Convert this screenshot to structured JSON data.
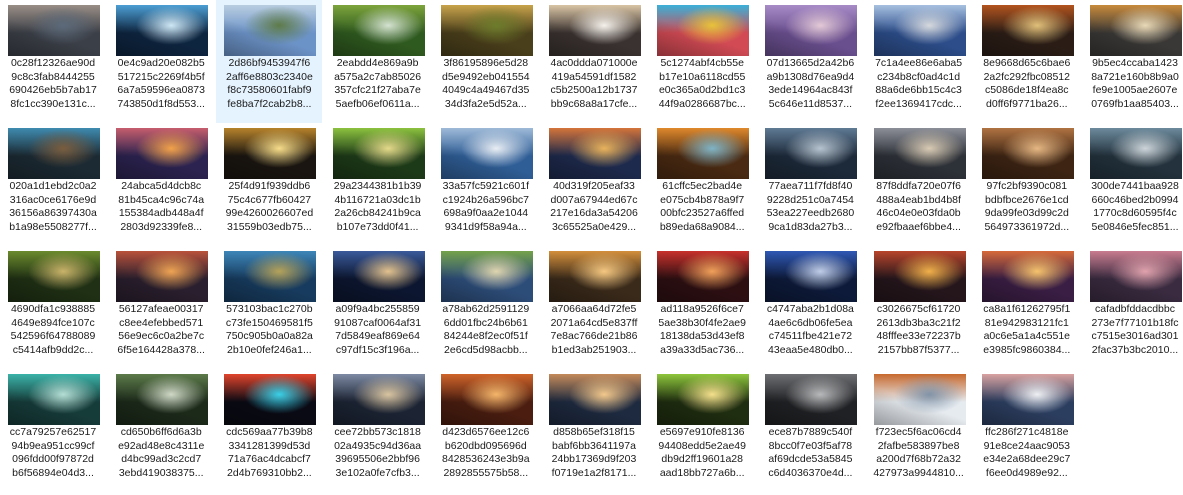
{
  "files": [
    {
      "lines": [
        "0c28f12326ae90d",
        "9c8c3fab8444255",
        "690426eb5b7ab17",
        "8fc1cc390e131c..."
      ],
      "icon": "image-thumbnail-canyon",
      "selected": false,
      "colors": [
        "#3b3f47",
        "#9a8e86",
        "#5c6a7a"
      ]
    },
    {
      "lines": [
        "0e4c9ad20e082b5",
        "517215c2269f4b5f",
        "6a7a59596ea0873",
        "743850d1f8d553..."
      ],
      "icon": "image-thumbnail-ice-cave",
      "selected": false,
      "colors": [
        "#0e2540",
        "#4c9fd4",
        "#cfe7f5"
      ]
    },
    {
      "lines": [
        "2d86bf9453947f6",
        "2aff6e8803c2340e",
        "f8c73580601fabf9",
        "fe8ba7f2cab2b8..."
      ],
      "icon": "image-thumbnail-mountain-valley",
      "selected": true,
      "colors": [
        "#6c93c8",
        "#b9cde0",
        "#5e7b49"
      ]
    },
    {
      "lines": [
        "2eabdd4e869a9b",
        "a575a2c7ab85026",
        "357cfc21f27aba7e",
        "5aefb06ef0611a..."
      ],
      "icon": "image-thumbnail-waterfall",
      "selected": false,
      "colors": [
        "#2f5a1f",
        "#7da43c",
        "#d4e2d0"
      ]
    },
    {
      "lines": [
        "3f86195896e5d28",
        "d5e9492eb041554",
        "4049c4a49467d35",
        "34d3fa2e5d52a..."
      ],
      "icon": "image-thumbnail-forest-path",
      "selected": false,
      "colors": [
        "#4a3f1b",
        "#c8a34b",
        "#6d7c2c"
      ]
    },
    {
      "lines": [
        "4ac0ddda071000e",
        "419a54591df1582",
        "c5b2500a12b1737",
        "bb9c68a8a17cfe..."
      ],
      "icon": "image-thumbnail-snowy-sunset",
      "selected": false,
      "colors": [
        "#3a3230",
        "#d9c4a4",
        "#f5f1eb"
      ]
    },
    {
      "lines": [
        "5c1274abf4cb55e",
        "b17e10a6118cd55",
        "e0c365a0d2bd1c3",
        "44f9a0286687bc..."
      ],
      "icon": "image-thumbnail-paint-pots",
      "selected": false,
      "colors": [
        "#d14a54",
        "#3bb0d8",
        "#e8c23a"
      ]
    },
    {
      "lines": [
        "07d13665d2a42b6",
        "a9b1308d76ea9d4",
        "3ede14964ac843f",
        "5c646e11d8537..."
      ],
      "icon": "image-thumbnail-lavender-field",
      "selected": false,
      "colors": [
        "#6a4f8f",
        "#a78bc7",
        "#e3c9d6"
      ]
    },
    {
      "lines": [
        "7c1a4ee86e6aba5",
        "c234b8cf0ad4c1d",
        "88a6de6bb15c4c3",
        "f2ee1369417cdc..."
      ],
      "icon": "image-thumbnail-bridge",
      "selected": false,
      "colors": [
        "#2c4d8a",
        "#a7c0e0",
        "#d6d9dd"
      ]
    },
    {
      "lines": [
        "8e9668d65c6bae6",
        "2a2fc292fbc08512",
        "c5086de18f4ea8c",
        "d0ff6f9771ba26..."
      ],
      "icon": "image-thumbnail-spices",
      "selected": false,
      "colors": [
        "#2b1d16",
        "#b3541e",
        "#e0c07a"
      ]
    },
    {
      "lines": [
        "9b5ec4ccaba1423",
        "8a721e160b8b9a0",
        "fe9e1005ae2607e",
        "0769fb1aa85403..."
      ],
      "icon": "image-thumbnail-spice-bowls",
      "selected": false,
      "colors": [
        "#3a3836",
        "#c88a3c",
        "#e8d9b8"
      ]
    },
    {
      "lines": [
        "020a1d1ebd2c0a2",
        "316ac0ce6176e9d",
        "36156a86397430a",
        "b1a98e5508277f..."
      ],
      "icon": "image-thumbnail-cave-lake",
      "selected": false,
      "colors": [
        "#1c2a33",
        "#3f8bb0",
        "#7a5d3e"
      ]
    },
    {
      "lines": [
        "24abca5d4dcb8c",
        "81b45ca4c96c74a",
        "155384adb448a4f",
        "2803d92339fe8..."
      ],
      "icon": "image-thumbnail-pier-sunset",
      "selected": false,
      "colors": [
        "#2c2350",
        "#c65d6d",
        "#f2a24a"
      ]
    },
    {
      "lines": [
        "25f4d91f939ddb6",
        "75c4c677fb60427",
        "99e4260026607ed",
        "31559b03edb75..."
      ],
      "icon": "image-thumbnail-light-bulb",
      "selected": false,
      "colors": [
        "#1a1510",
        "#b7832c",
        "#f6dc8a"
      ]
    },
    {
      "lines": [
        "29a2344381b1b39",
        "4b116721a03dc1b",
        "2a26cb84241b9ca",
        "b107e73dd0f41..."
      ],
      "icon": "image-thumbnail-green-corridor",
      "selected": false,
      "colors": [
        "#1d3a18",
        "#8cc23f",
        "#e4d98a"
      ]
    },
    {
      "lines": [
        "33a57fc5921c601f",
        "c1924b26a596bc7",
        "698a9f0aa2e1044",
        "9341d9f58a94a..."
      ],
      "icon": "image-thumbnail-lake-reflection",
      "selected": false,
      "colors": [
        "#2f5e96",
        "#9fbad8",
        "#e9eef4"
      ]
    },
    {
      "lines": [
        "40d319f205eaf33",
        "d007a67944ed67c",
        "217e16da3a54206",
        "3c65525a0e429..."
      ],
      "icon": "image-thumbnail-canal-houses",
      "selected": false,
      "colors": [
        "#1e2a4d",
        "#d4743a",
        "#e8b35c"
      ]
    },
    {
      "lines": [
        "61cffc5ec2bad4e",
        "e075cb4b878a9f7",
        "00bfc23527a6ffed",
        "b89eda68a9084..."
      ],
      "icon": "image-thumbnail-autumn-waterfall",
      "selected": false,
      "colors": [
        "#4a2a12",
        "#e0892c",
        "#7fb4c7"
      ]
    },
    {
      "lines": [
        "77aea711f7fd8f40",
        "9228d251c0a7454",
        "53ea227eedb2680",
        "9ca1d83da27b3..."
      ],
      "icon": "image-thumbnail-rocky-coast",
      "selected": false,
      "colors": [
        "#1d2a3a",
        "#5f7a94",
        "#b6c3cf"
      ]
    },
    {
      "lines": [
        "87f8ddfa720e07f6",
        "488a4eab1bd4b8f",
        "46c04e0e03fda0b",
        "e92fbaaef6bbe4..."
      ],
      "icon": "image-thumbnail-misty-peaks",
      "selected": false,
      "colors": [
        "#2d3138",
        "#8c8f98",
        "#d9cbb4"
      ]
    },
    {
      "lines": [
        "97fc2bf9390c081",
        "bdbfbce2676e1cd",
        "9da99fe03d99c2d",
        "564973361972d..."
      ],
      "icon": "image-thumbnail-wooden-columns",
      "selected": false,
      "colors": [
        "#3d2413",
        "#b07342",
        "#e6b783"
      ]
    },
    {
      "lines": [
        "300de7441baa928",
        "660c46bed2b0994",
        "1770c8d60595f4c",
        "5e0846e5fec851..."
      ],
      "icon": "image-thumbnail-ocean-rocks",
      "selected": false,
      "colors": [
        "#23323d",
        "#6c8a9c",
        "#cdd5da"
      ]
    },
    {
      "lines": [
        "4690dfa1c938885",
        "4649e894fce107c",
        "542596f64788089",
        "c5414afb9dd2c..."
      ],
      "icon": "image-thumbnail-jungle-pipe",
      "selected": false,
      "colors": [
        "#1f3014",
        "#6b8a2d",
        "#c9b36a"
      ]
    },
    {
      "lines": [
        "56127afeae00317",
        "c8ee4efebbed571",
        "56e9ec6c0a2be7c",
        "6f5e164428a378..."
      ],
      "icon": "image-thumbnail-sunset-mountains",
      "selected": false,
      "colors": [
        "#2a1f2e",
        "#b9523b",
        "#efa454"
      ]
    },
    {
      "lines": [
        "573103bac1c270b",
        "c73fe150469581f5",
        "750c905b0a0a82a",
        "2b10e0fef246a1..."
      ],
      "icon": "image-thumbnail-blue-lake",
      "selected": false,
      "colors": [
        "#173b5e",
        "#3d86b8",
        "#b5a25a"
      ]
    },
    {
      "lines": [
        "a09f9a4bc255859",
        "91087caf0064af31",
        "7d5849eaf869e64",
        "c97df15c3f196a..."
      ],
      "icon": "image-thumbnail-milky-way",
      "selected": false,
      "colors": [
        "#0c1630",
        "#3a5a9a",
        "#e2c28e"
      ]
    },
    {
      "lines": [
        "a78ab62d2591129",
        "6dd01fbc24b6b61",
        "84244e8f2ec0f51f",
        "2e6cd5d98acbb..."
      ],
      "icon": "image-thumbnail-meadow-peaks",
      "selected": false,
      "colors": [
        "#2d4d79",
        "#74a24a",
        "#dfd5b0"
      ]
    },
    {
      "lines": [
        "a7066aa64d72fe5",
        "2071a64cd5e837ff",
        "7e8ac766de21b86",
        "b1ed3ab251903..."
      ],
      "icon": "image-thumbnail-desert-road",
      "selected": false,
      "colors": [
        "#3a2a1a",
        "#d38f3c",
        "#f5c881"
      ]
    },
    {
      "lines": [
        "ad118a9526f6ce7",
        "5ae38b30f4fe2ae9",
        "18138da53d43ef8",
        "a39a33d5ac736..."
      ],
      "icon": "image-thumbnail-red-sunset",
      "selected": false,
      "colors": [
        "#2d0f12",
        "#c8312c",
        "#f0a05a"
      ]
    },
    {
      "lines": [
        "c4747aba2b1d08a",
        "4ae6c6db06fe5ea",
        "c74511fbe421e72",
        "43eaa5e480db0..."
      ],
      "icon": "image-thumbnail-spiral-stairs",
      "selected": false,
      "colors": [
        "#0d1a3a",
        "#2f58b4",
        "#c0cde8"
      ]
    },
    {
      "lines": [
        "c3026675cf61720",
        "2613db3ba3c21f2",
        "48fffee33e72237b",
        "2157bb87f5377..."
      ],
      "icon": "image-thumbnail-fiery-horizon",
      "selected": false,
      "colors": [
        "#25161c",
        "#b8452b",
        "#f0b04a"
      ]
    },
    {
      "lines": [
        "ca8a1f61262795f1",
        "81e942983121fc1",
        "a0c6e5a1a4c551e",
        "e3985fc9860384..."
      ],
      "icon": "image-thumbnail-bridge-tunnel",
      "selected": false,
      "colors": [
        "#3a1e44",
        "#d66a3a",
        "#f6c36d"
      ]
    },
    {
      "lines": [
        "cafadbfddacdbbc",
        "273e7f77101b18fc",
        "c7515e3016ad301",
        "2fac37b3bc2010..."
      ],
      "icon": "image-thumbnail-pink-lake",
      "selected": false,
      "colors": [
        "#3a2b40",
        "#c97c8f",
        "#e0a2ad"
      ]
    },
    {
      "lines": [
        "cc7a79257e62517",
        "94b9ea951cc99cf",
        "096fdd00f97872d",
        "b6f56894e04d3..."
      ],
      "icon": "image-thumbnail-turquoise-river",
      "selected": false,
      "colors": [
        "#163c3a",
        "#3bb3a8",
        "#b4ded5"
      ]
    },
    {
      "lines": [
        "cd650b6ff6d6a3b",
        "e92ad48e8c4311e",
        "d4bc99ad3c2cd7",
        "3ebd419038375..."
      ],
      "icon": "image-thumbnail-forest-stream",
      "selected": false,
      "colors": [
        "#1c2a1a",
        "#5c7a4a",
        "#cfd8c6"
      ]
    },
    {
      "lines": [
        "cdc569aa77b39b8",
        "3341281399d53d",
        "71a76ac4dcabcf7",
        "2d4b769310bb2..."
      ],
      "icon": "image-thumbnail-light-trails",
      "selected": false,
      "colors": [
        "#0a0a14",
        "#e0442c",
        "#3ad0e8"
      ]
    },
    {
      "lines": [
        "cee72bb573c1818",
        "02a4935c94d36aa",
        "39695506e2bbf96",
        "3e102a0fe7cfb3..."
      ],
      "icon": "image-thumbnail-suspension-bridge",
      "selected": false,
      "colors": [
        "#1c2434",
        "#7d8aa3",
        "#d9c4a0"
      ]
    },
    {
      "lines": [
        "d423d6576ee12c6",
        "b620dbd095696d",
        "8428536243e3b9a",
        "2892855575b58..."
      ],
      "icon": "image-thumbnail-antelope-canyon",
      "selected": false,
      "colors": [
        "#4a1d10",
        "#d0642a",
        "#f4b56a"
      ]
    },
    {
      "lines": [
        "d858b65ef318f15",
        "babf6bb3641197a",
        "24bb17369d9f203",
        "f0719e1a2f8171..."
      ],
      "icon": "image-thumbnail-boulders-beach",
      "selected": false,
      "colors": [
        "#1e2a40",
        "#c48a5a",
        "#f2c88c"
      ]
    },
    {
      "lines": [
        "e5697e910fe8136",
        "94408edd5e2ae49",
        "db9d2ff19601a28",
        "aad18bb727a6b..."
      ],
      "icon": "image-thumbnail-green-tunnel",
      "selected": false,
      "colors": [
        "#1f2d10",
        "#8ec63c",
        "#f4e08c"
      ]
    },
    {
      "lines": [
        "ece87b7889c540f",
        "8bcc0f7e03f5af78",
        "af69dcde53a5845",
        "c6d4036370e4d..."
      ],
      "icon": "image-thumbnail-gears",
      "selected": false,
      "colors": [
        "#202124",
        "#6e6f72",
        "#b8b9bb"
      ]
    },
    {
      "lines": [
        "f723ec5f6ac06cd4",
        "2fafbe583897be8",
        "a200d7f68b72a32",
        "427973a9944810..."
      ],
      "icon": "image-thumbnail-snow-fox",
      "selected": false,
      "colors": [
        "#e6ebf0",
        "#c7692e",
        "#8294a8"
      ]
    },
    {
      "lines": [
        "ffc286f271c4818e",
        "91e8ce24aac9053",
        "e34e2a68dee29c7",
        "f6ee0d4989e92..."
      ],
      "icon": "image-thumbnail-snowy-valley",
      "selected": false,
      "colors": [
        "#2c3e60",
        "#d8a2a0",
        "#eef0f4"
      ]
    }
  ]
}
